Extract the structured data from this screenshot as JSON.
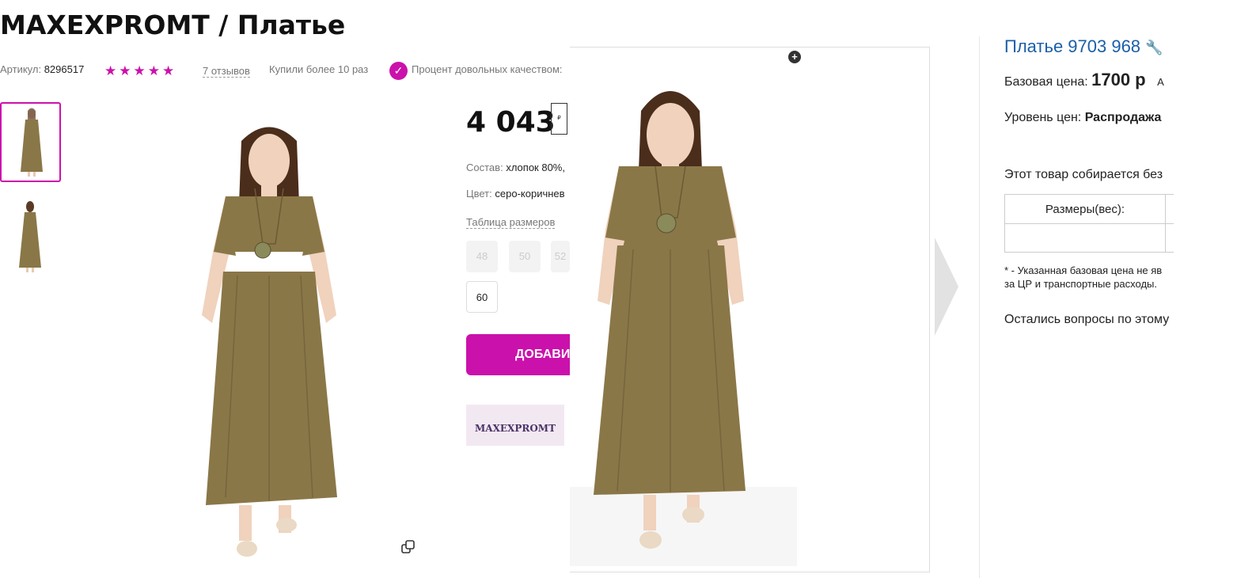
{
  "product": {
    "title": "MAXEXPROMT / Платье",
    "article_label": "Артикул:",
    "article_value": "8296517",
    "stars": "★★★★★",
    "reviews": "7 отзывов",
    "bought": "Купили более 10 раз",
    "satisfaction": "Процент довольных качеством:",
    "price": "4 043",
    "currency_icon": "₽",
    "composition_label": "Состав:",
    "composition_value": "хлопок 80%,",
    "color_label": "Цвет:",
    "color_value": "серо-коричнев",
    "size_table": "Таблица размеров",
    "sizes": [
      "48",
      "50",
      "52"
    ],
    "selected_size": "60",
    "add_button": "ДОБАВИТЬ",
    "brand_logo": "MAXEXPROMT"
  },
  "side_panel": {
    "title": "Платье 9703 968",
    "base_price_label": "Базовая цена:",
    "base_price_value": "1700 р",
    "base_price_extra": "А",
    "price_level_label": "Уровень цен:",
    "price_level_value": "Распродажа",
    "note": "Этот товар собирается без",
    "table_header": "Размеры(вес):",
    "footnote_1": "* - Указанная базовая цена не яв",
    "footnote_2": "за ЦР и транспортные расходы.",
    "question": "Остались вопросы по этому"
  },
  "colors": {
    "accent": "#cb11ab",
    "link": "#1a5fa8",
    "dress": "#8a7748"
  }
}
